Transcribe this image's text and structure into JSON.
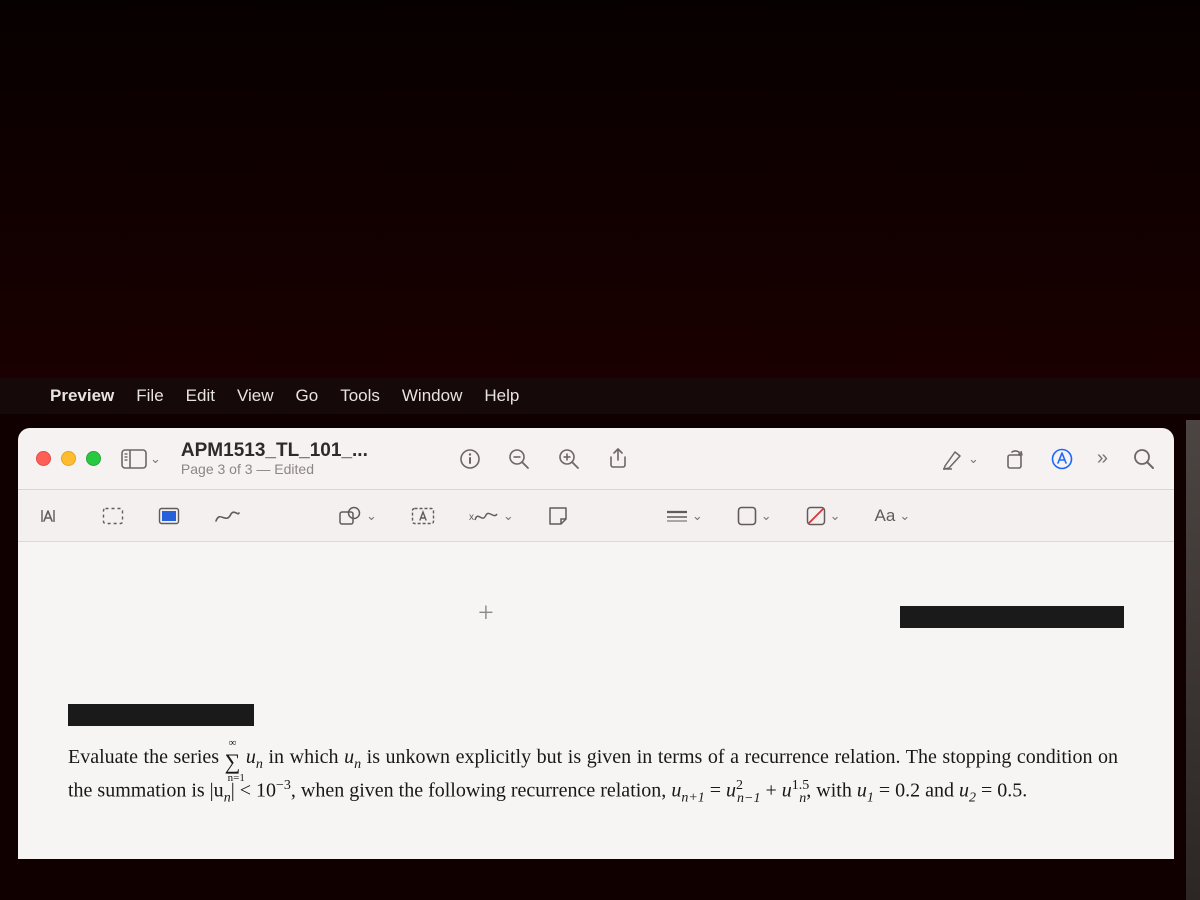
{
  "menubar": {
    "app": "Preview",
    "items": [
      "File",
      "Edit",
      "View",
      "Go",
      "Tools",
      "Window",
      "Help"
    ]
  },
  "window": {
    "title": "APM1513_TL_101_...",
    "subtitle": "Page 3 of 3 — Edited"
  },
  "toolbar": {
    "text_style_label": "Aa"
  },
  "document": {
    "plus": "+",
    "para1a": "Evaluate the series ",
    "sum_top": "∞",
    "sum_bottom": "n=1",
    "para1b": " in which ",
    "para1c": " is unkown explicitly but is given in terms of a recurrence relation. The stopping condition on the summation is ",
    "stop_cond_lhs": "|u",
    "stop_cond_sub": "n",
    "stop_cond_rhs": "| < 10",
    "stop_cond_exp": "−3",
    "para1d": ", when given the following recurrence relation, ",
    "rec_lhs": "u",
    "rec_lhs_sub": "n+1",
    "rec_eq": " = ",
    "rec_t1": "u",
    "rec_t1_sup": "2",
    "rec_t1_sub": "n−1",
    "rec_plus": " + ",
    "rec_t2": "u",
    "rec_t2_sup": "1.5",
    "rec_t2_sub": "n",
    "rec_tail": ", with ",
    "ic1": "u",
    "ic1_sub": "1",
    "ic1_val": " = 0.2",
    "and": " and ",
    "ic2": "u",
    "ic2_sub": "2",
    "ic2_val": " = 0.5.",
    "un_var": "u",
    "un_sub": "n"
  }
}
